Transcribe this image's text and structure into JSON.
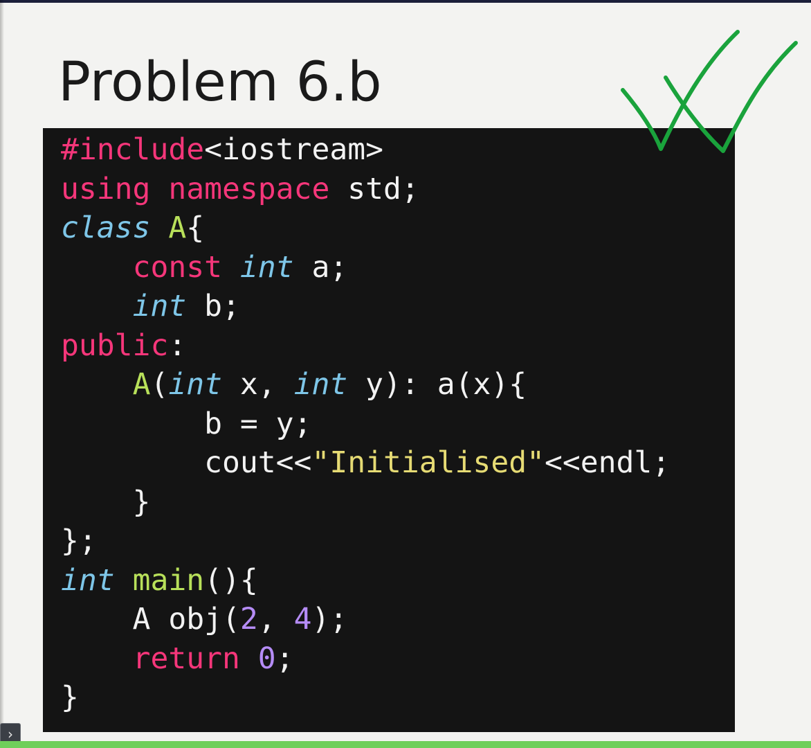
{
  "slide": {
    "title": "Problem 6.b"
  },
  "code": {
    "lines": [
      [
        {
          "t": "#include",
          "c": "kw-red"
        },
        {
          "t": "<iostream>",
          "c": "plain"
        }
      ],
      [
        {
          "t": "using",
          "c": "kw-red"
        },
        {
          "t": " ",
          "c": "plain"
        },
        {
          "t": "namespace",
          "c": "kw-red"
        },
        {
          "t": " std;",
          "c": "plain"
        }
      ],
      [
        {
          "t": "class",
          "c": "kw-blue"
        },
        {
          "t": " ",
          "c": "plain"
        },
        {
          "t": "A",
          "c": "fn-green"
        },
        {
          "t": "{",
          "c": "plain"
        }
      ],
      [
        {
          "t": "    ",
          "c": "plain"
        },
        {
          "t": "const",
          "c": "kw-red"
        },
        {
          "t": " ",
          "c": "plain"
        },
        {
          "t": "int",
          "c": "kw-blue"
        },
        {
          "t": " a;",
          "c": "plain"
        }
      ],
      [
        {
          "t": "    ",
          "c": "plain"
        },
        {
          "t": "int",
          "c": "kw-blue"
        },
        {
          "t": " b;",
          "c": "plain"
        }
      ],
      [
        {
          "t": "public",
          "c": "kw-red"
        },
        {
          "t": ":",
          "c": "plain"
        }
      ],
      [
        {
          "t": "    ",
          "c": "plain"
        },
        {
          "t": "A",
          "c": "fn-green"
        },
        {
          "t": "(",
          "c": "plain"
        },
        {
          "t": "int",
          "c": "kw-blue"
        },
        {
          "t": " x, ",
          "c": "plain"
        },
        {
          "t": "int",
          "c": "kw-blue"
        },
        {
          "t": " y): a(x){",
          "c": "plain"
        }
      ],
      [
        {
          "t": "        b = y;",
          "c": "plain"
        }
      ],
      [
        {
          "t": "        cout<<",
          "c": "plain"
        },
        {
          "t": "\"Initialised\"",
          "c": "str-yellow"
        },
        {
          "t": "<<endl;",
          "c": "plain"
        }
      ],
      [
        {
          "t": "    }",
          "c": "plain"
        }
      ],
      [
        {
          "t": "};",
          "c": "plain"
        }
      ],
      [
        {
          "t": "int",
          "c": "kw-blue"
        },
        {
          "t": " ",
          "c": "plain"
        },
        {
          "t": "main",
          "c": "fn-green"
        },
        {
          "t": "(){",
          "c": "plain"
        }
      ],
      [
        {
          "t": "    A obj(",
          "c": "plain"
        },
        {
          "t": "2",
          "c": "num-purple"
        },
        {
          "t": ", ",
          "c": "plain"
        },
        {
          "t": "4",
          "c": "num-purple"
        },
        {
          "t": ");",
          "c": "plain"
        }
      ],
      [
        {
          "t": "    ",
          "c": "plain"
        },
        {
          "t": "return",
          "c": "kw-red"
        },
        {
          "t": " ",
          "c": "plain"
        },
        {
          "t": "0",
          "c": "num-purple"
        },
        {
          "t": ";",
          "c": "plain"
        }
      ],
      [
        {
          "t": "}",
          "c": "plain"
        }
      ]
    ]
  },
  "annotation": {
    "color": "#1aa33c",
    "icon": "double-checkmark-icon"
  },
  "nav": {
    "arrow_glyph": "›",
    "icon": "chevron-right-icon"
  }
}
